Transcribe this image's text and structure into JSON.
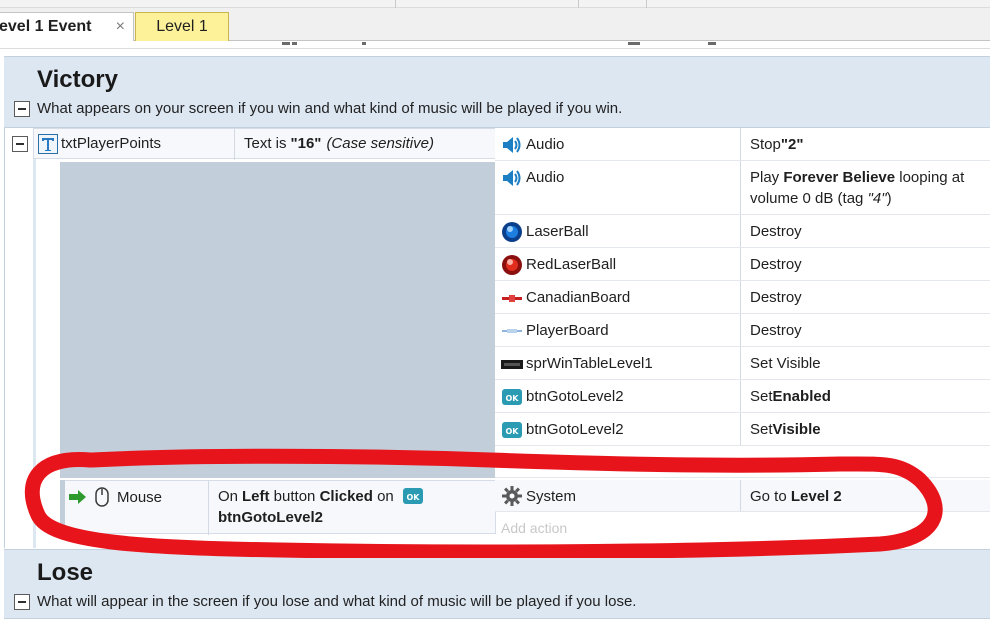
{
  "tabs": [
    {
      "label": "evel 1 Event",
      "close_glyph": "×",
      "active": true
    },
    {
      "label": "Level 1",
      "active": false
    }
  ],
  "groups": {
    "victory": {
      "title": "Victory",
      "description": "What appears on your screen if you win and what kind of music will be played if you win."
    },
    "lose": {
      "title": "Lose",
      "description": "What will appear in the screen if you lose and what kind of music will be played if you lose."
    }
  },
  "event1": {
    "condition": {
      "object": "txtPlayerPoints",
      "text_prefix": "Text is ",
      "text_value": "\"16\"",
      "text_suffix": "(Case sensitive)"
    },
    "actions": [
      {
        "icon": "speaker-icon",
        "object": "Audio",
        "parts": [
          {
            "t": "Stop ",
            "s": ""
          },
          {
            "t": "\"2\"",
            "s": "b"
          }
        ]
      },
      {
        "icon": "speaker-icon",
        "object": "Audio",
        "parts": [
          {
            "t": "Play ",
            "s": ""
          },
          {
            "t": "Forever Believe",
            "s": "b"
          },
          {
            "t": " looping at",
            "s": ""
          }
        ],
        "line2": "volume 0 dB (tag ",
        "line2_italic": "\"4\"",
        "line2_end": ")"
      },
      {
        "icon": "blue-ball-icon",
        "object": "LaserBall",
        "parts": [
          {
            "t": "Destroy",
            "s": ""
          }
        ]
      },
      {
        "icon": "red-ball-icon",
        "object": "RedLaserBall",
        "parts": [
          {
            "t": "Destroy",
            "s": ""
          }
        ]
      },
      {
        "icon": "red-board-icon",
        "object": "CanadianBoard",
        "parts": [
          {
            "t": "Destroy",
            "s": ""
          }
        ]
      },
      {
        "icon": "blue-board-icon",
        "object": "PlayerBoard",
        "parts": [
          {
            "t": "Destroy",
            "s": ""
          }
        ]
      },
      {
        "icon": "sprite-icon",
        "object": "sprWinTableLevel1",
        "parts": [
          {
            "t": "Set Visible",
            "s": ""
          }
        ]
      },
      {
        "icon": "ok-button-icon",
        "object": "btnGotoLevel2",
        "parts": [
          {
            "t": "Set ",
            "s": ""
          },
          {
            "t": "Enabled",
            "s": "b"
          }
        ]
      },
      {
        "icon": "ok-button-icon",
        "object": "btnGotoLevel2",
        "parts": [
          {
            "t": "Set ",
            "s": ""
          },
          {
            "t": "Visible",
            "s": "b"
          }
        ]
      }
    ]
  },
  "event2": {
    "condition": {
      "object": "Mouse",
      "on": "On ",
      "left": "Left",
      "button": " button ",
      "clicked": "Clicked",
      "on2": " on",
      "target": "btnGotoLevel2"
    },
    "action": {
      "object": "System",
      "text": "Go to ",
      "bold": "Level 2"
    },
    "add_action": "Add action"
  },
  "ok_badge": "OK",
  "annotation_color": "#e8141b"
}
